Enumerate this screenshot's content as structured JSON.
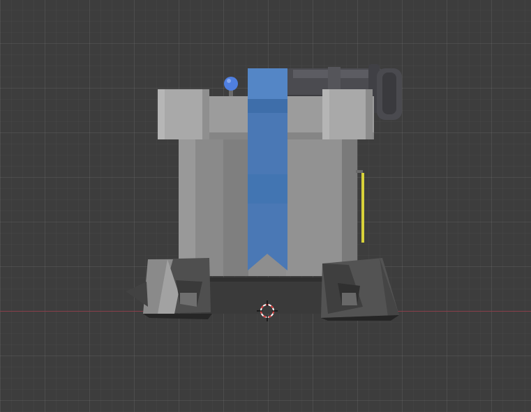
{
  "viewport": {
    "name": "3D Viewport",
    "background": "#3d3d3d",
    "grid_color": "#474747",
    "x_axis_color": "#8a3f4a"
  },
  "scene": {
    "object": "tower",
    "colors": {
      "stone_light": "#a8a8a8",
      "stone_mid": "#8e8e8e",
      "stone_dark": "#5a5a5a",
      "banner": "#4a78b5",
      "banner_dark": "#3d6aa3",
      "cannon": "#4b4b50",
      "orb": "#4f7fe0",
      "gizmo_yellow": "#d8d23a"
    }
  },
  "cursor": {
    "icon": "3d-cursor-icon",
    "ring_color": "#d83a3a"
  }
}
